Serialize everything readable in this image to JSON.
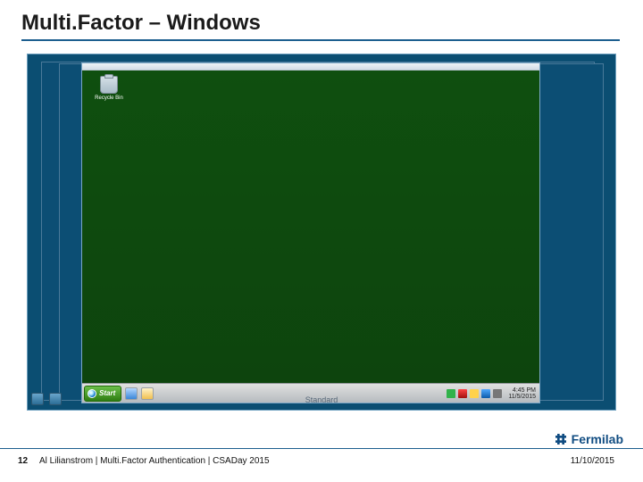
{
  "slide": {
    "title": "Multi.Factor – Windows",
    "page_number": "12",
    "footer_text": "Al Lilianstrom | Multi.Factor Authentication | CSADay 2015",
    "footer_date": "11/10/2015"
  },
  "logo": {
    "text": "Fermilab"
  },
  "remote_desktop": {
    "recycle_bin_label": "Recycle Bin",
    "start_label": "Start",
    "clock_time": "4:45 PM",
    "clock_date": "11/5/2015"
  },
  "background_strip": {
    "center_label": "Standard"
  }
}
